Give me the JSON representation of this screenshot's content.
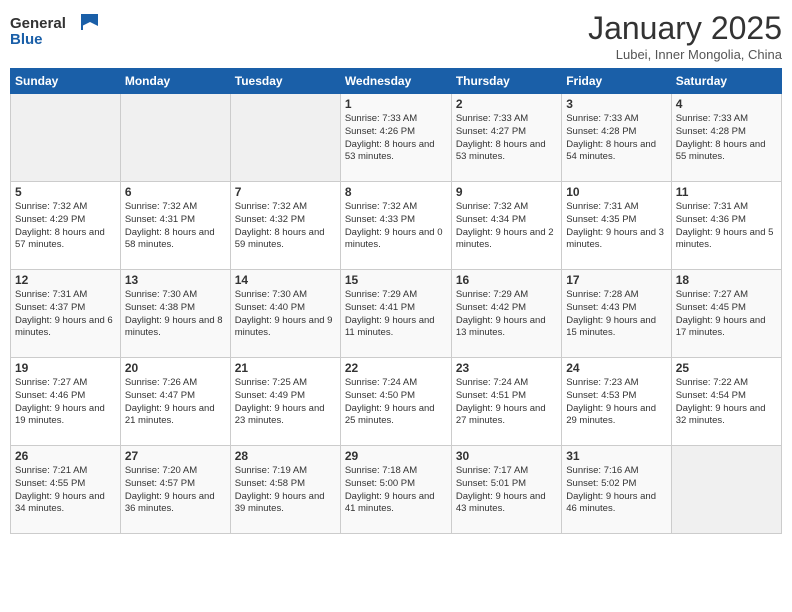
{
  "header": {
    "logo_general": "General",
    "logo_blue": "Blue",
    "month_title": "January 2025",
    "location": "Lubei, Inner Mongolia, China"
  },
  "calendar": {
    "days_of_week": [
      "Sunday",
      "Monday",
      "Tuesday",
      "Wednesday",
      "Thursday",
      "Friday",
      "Saturday"
    ],
    "weeks": [
      {
        "cells": [
          {
            "empty": true
          },
          {
            "empty": true
          },
          {
            "empty": true
          },
          {
            "day": 1,
            "sunrise": "7:33 AM",
            "sunset": "4:26 PM",
            "daylight": "8 hours and 53 minutes."
          },
          {
            "day": 2,
            "sunrise": "7:33 AM",
            "sunset": "4:27 PM",
            "daylight": "8 hours and 53 minutes."
          },
          {
            "day": 3,
            "sunrise": "7:33 AM",
            "sunset": "4:28 PM",
            "daylight": "8 hours and 54 minutes."
          },
          {
            "day": 4,
            "sunrise": "7:33 AM",
            "sunset": "4:28 PM",
            "daylight": "8 hours and 55 minutes."
          }
        ]
      },
      {
        "cells": [
          {
            "day": 5,
            "sunrise": "7:32 AM",
            "sunset": "4:29 PM",
            "daylight": "8 hours and 57 minutes."
          },
          {
            "day": 6,
            "sunrise": "7:32 AM",
            "sunset": "4:31 PM",
            "daylight": "8 hours and 58 minutes."
          },
          {
            "day": 7,
            "sunrise": "7:32 AM",
            "sunset": "4:32 PM",
            "daylight": "8 hours and 59 minutes."
          },
          {
            "day": 8,
            "sunrise": "7:32 AM",
            "sunset": "4:33 PM",
            "daylight": "9 hours and 0 minutes."
          },
          {
            "day": 9,
            "sunrise": "7:32 AM",
            "sunset": "4:34 PM",
            "daylight": "9 hours and 2 minutes."
          },
          {
            "day": 10,
            "sunrise": "7:31 AM",
            "sunset": "4:35 PM",
            "daylight": "9 hours and 3 minutes."
          },
          {
            "day": 11,
            "sunrise": "7:31 AM",
            "sunset": "4:36 PM",
            "daylight": "9 hours and 5 minutes."
          }
        ]
      },
      {
        "cells": [
          {
            "day": 12,
            "sunrise": "7:31 AM",
            "sunset": "4:37 PM",
            "daylight": "9 hours and 6 minutes."
          },
          {
            "day": 13,
            "sunrise": "7:30 AM",
            "sunset": "4:38 PM",
            "daylight": "9 hours and 8 minutes."
          },
          {
            "day": 14,
            "sunrise": "7:30 AM",
            "sunset": "4:40 PM",
            "daylight": "9 hours and 9 minutes."
          },
          {
            "day": 15,
            "sunrise": "7:29 AM",
            "sunset": "4:41 PM",
            "daylight": "9 hours and 11 minutes."
          },
          {
            "day": 16,
            "sunrise": "7:29 AM",
            "sunset": "4:42 PM",
            "daylight": "9 hours and 13 minutes."
          },
          {
            "day": 17,
            "sunrise": "7:28 AM",
            "sunset": "4:43 PM",
            "daylight": "9 hours and 15 minutes."
          },
          {
            "day": 18,
            "sunrise": "7:27 AM",
            "sunset": "4:45 PM",
            "daylight": "9 hours and 17 minutes."
          }
        ]
      },
      {
        "cells": [
          {
            "day": 19,
            "sunrise": "7:27 AM",
            "sunset": "4:46 PM",
            "daylight": "9 hours and 19 minutes."
          },
          {
            "day": 20,
            "sunrise": "7:26 AM",
            "sunset": "4:47 PM",
            "daylight": "9 hours and 21 minutes."
          },
          {
            "day": 21,
            "sunrise": "7:25 AM",
            "sunset": "4:49 PM",
            "daylight": "9 hours and 23 minutes."
          },
          {
            "day": 22,
            "sunrise": "7:24 AM",
            "sunset": "4:50 PM",
            "daylight": "9 hours and 25 minutes."
          },
          {
            "day": 23,
            "sunrise": "7:24 AM",
            "sunset": "4:51 PM",
            "daylight": "9 hours and 27 minutes."
          },
          {
            "day": 24,
            "sunrise": "7:23 AM",
            "sunset": "4:53 PM",
            "daylight": "9 hours and 29 minutes."
          },
          {
            "day": 25,
            "sunrise": "7:22 AM",
            "sunset": "4:54 PM",
            "daylight": "9 hours and 32 minutes."
          }
        ]
      },
      {
        "cells": [
          {
            "day": 26,
            "sunrise": "7:21 AM",
            "sunset": "4:55 PM",
            "daylight": "9 hours and 34 minutes."
          },
          {
            "day": 27,
            "sunrise": "7:20 AM",
            "sunset": "4:57 PM",
            "daylight": "9 hours and 36 minutes."
          },
          {
            "day": 28,
            "sunrise": "7:19 AM",
            "sunset": "4:58 PM",
            "daylight": "9 hours and 39 minutes."
          },
          {
            "day": 29,
            "sunrise": "7:18 AM",
            "sunset": "5:00 PM",
            "daylight": "9 hours and 41 minutes."
          },
          {
            "day": 30,
            "sunrise": "7:17 AM",
            "sunset": "5:01 PM",
            "daylight": "9 hours and 43 minutes."
          },
          {
            "day": 31,
            "sunrise": "7:16 AM",
            "sunset": "5:02 PM",
            "daylight": "9 hours and 46 minutes."
          },
          {
            "empty": true
          }
        ]
      }
    ]
  }
}
